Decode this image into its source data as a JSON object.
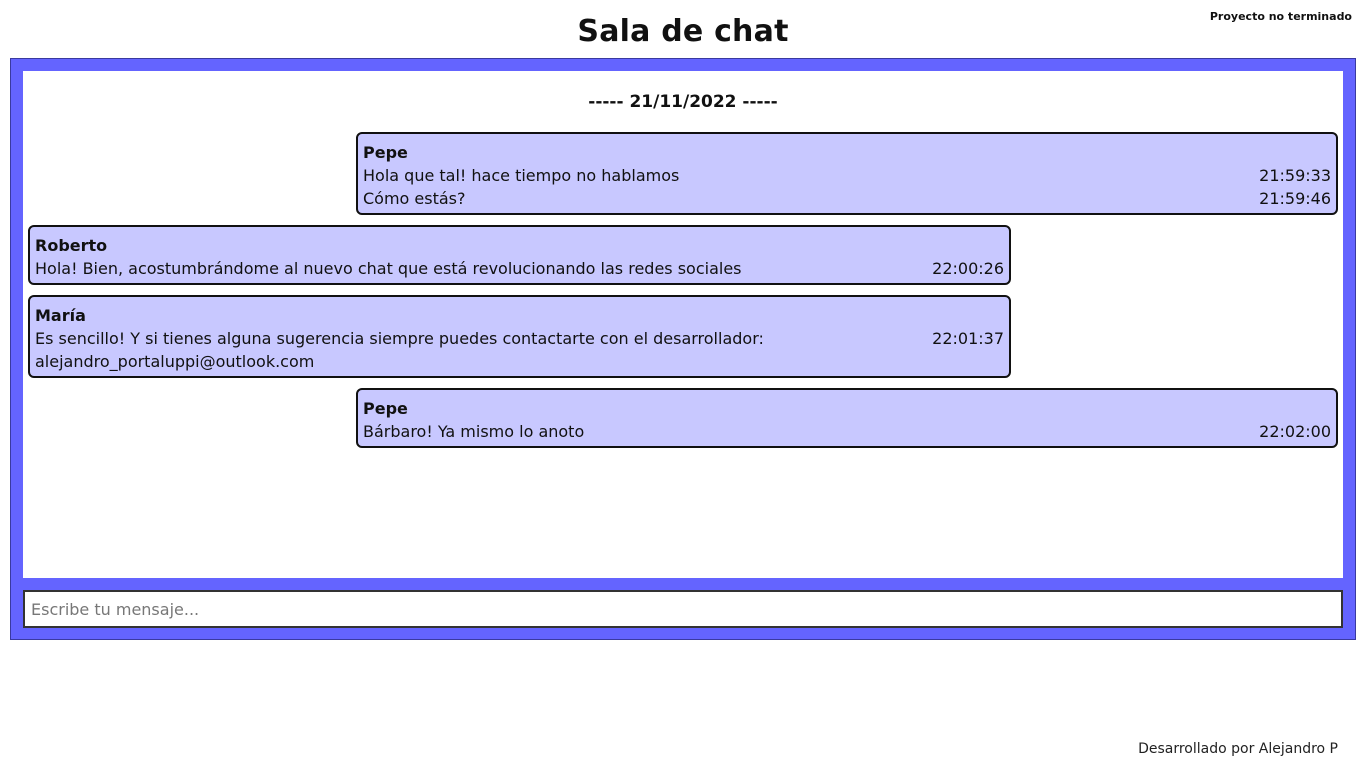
{
  "header": {
    "title": "Sala de chat",
    "note": "Proyecto no terminado"
  },
  "chat": {
    "date_divider": "----- 21/11/2022 -----",
    "messages": [
      {
        "author": "Pepe",
        "side": "right",
        "lines": [
          {
            "text": "Hola que tal! hace tiempo no hablamos",
            "time": "21:59:33"
          },
          {
            "text": "Cómo estás?",
            "time": "21:59:46"
          }
        ]
      },
      {
        "author": "Roberto",
        "side": "left",
        "lines": [
          {
            "text": "Hola! Bien, acostumbrándome al nuevo chat que está revolucionando las redes sociales",
            "time": "22:00:26"
          }
        ]
      },
      {
        "author": "María",
        "side": "left",
        "lines": [
          {
            "text": "Es sencillo! Y si tienes alguna sugerencia siempre puedes contactarte con el desarrollador:",
            "time": "22:01:37"
          },
          {
            "text": "alejandro_portaluppi@outlook.com",
            "time": ""
          }
        ]
      },
      {
        "author": "Pepe",
        "side": "right",
        "lines": [
          {
            "text": "Bárbaro! Ya mismo lo anoto",
            "time": "22:02:00"
          }
        ]
      }
    ]
  },
  "input": {
    "placeholder": "Escribe tu mensaje...",
    "value": ""
  },
  "footer": {
    "credit": "Desarrollado por Alejandro P"
  },
  "colors": {
    "frame": "#6464ff",
    "bubble": "#c8c8ff"
  }
}
